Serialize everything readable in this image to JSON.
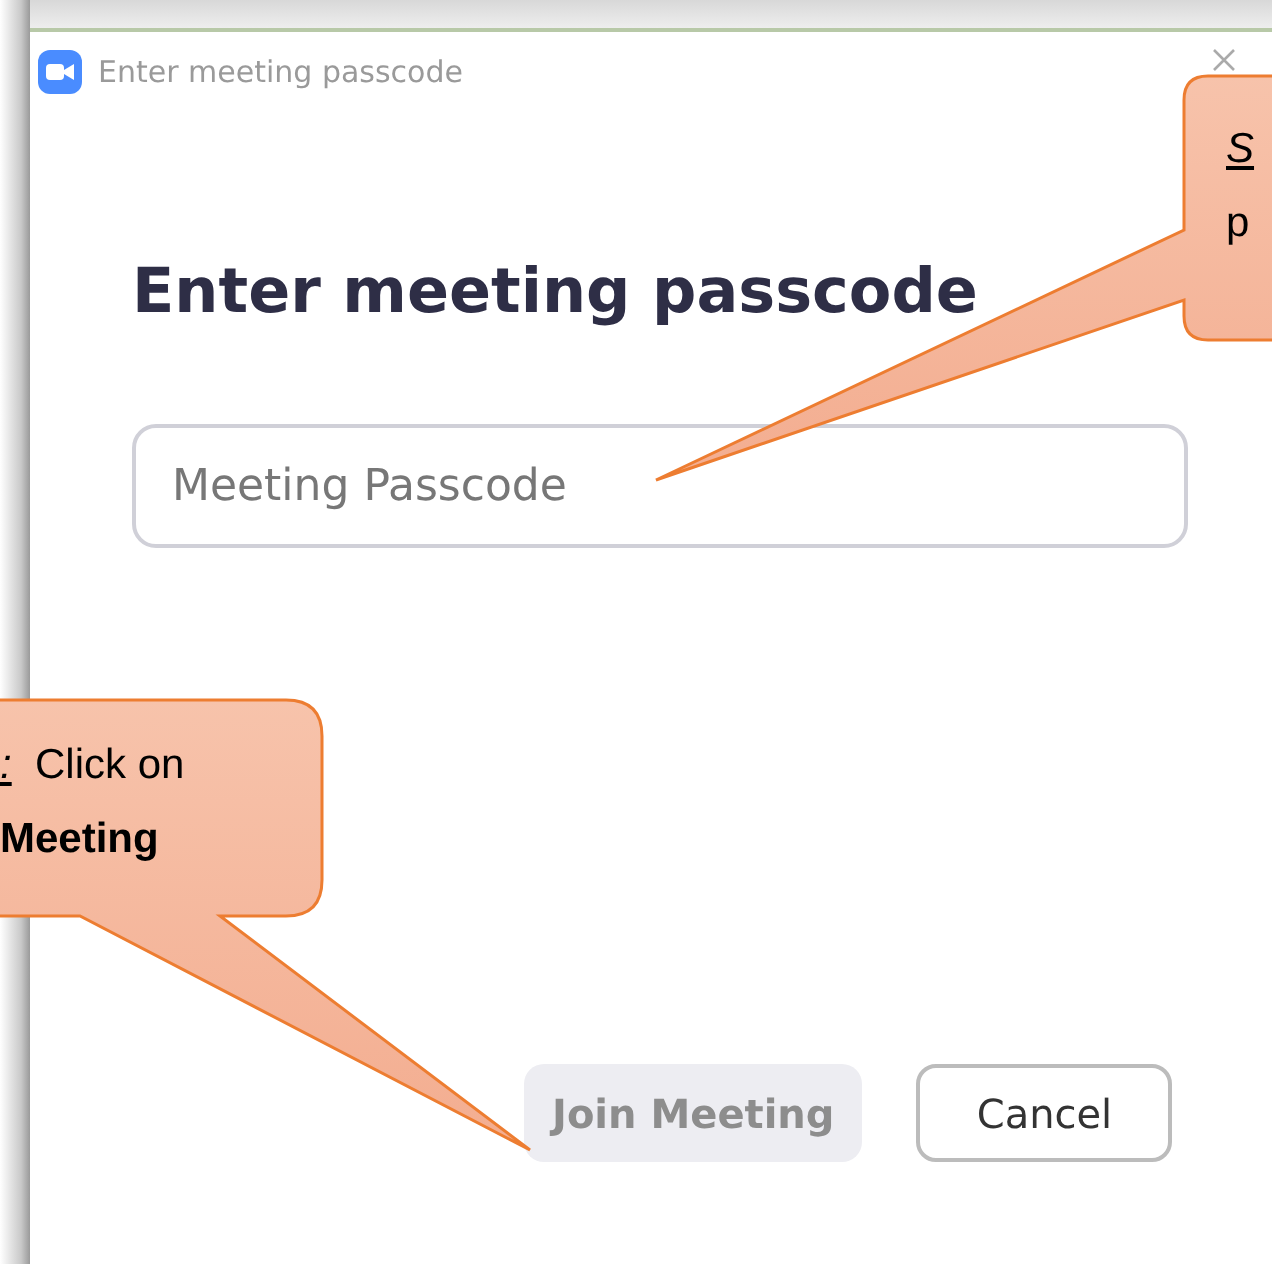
{
  "window": {
    "title": "Enter meeting passcode"
  },
  "heading": "Enter meeting passcode",
  "passcode_field": {
    "placeholder": "Meeting Passcode"
  },
  "buttons": [
    {
      "label": "Join Meeting",
      "kind": "primary",
      "disabled": true
    },
    {
      "label": "Cancel",
      "kind": "secondary",
      "disabled": false
    }
  ],
  "callouts": [
    {
      "lines": [
        [
          {
            "kind": "step",
            "text": "S"
          }
        ],
        [
          {
            "kind": "plain",
            "text": "p"
          }
        ]
      ]
    },
    {
      "lines": [
        [
          {
            "kind": "step",
            "text": ":"
          },
          {
            "kind": "plain",
            "text": "Click on"
          }
        ],
        [
          {
            "kind": "bold",
            "text": "Meeting"
          }
        ]
      ]
    }
  ]
}
